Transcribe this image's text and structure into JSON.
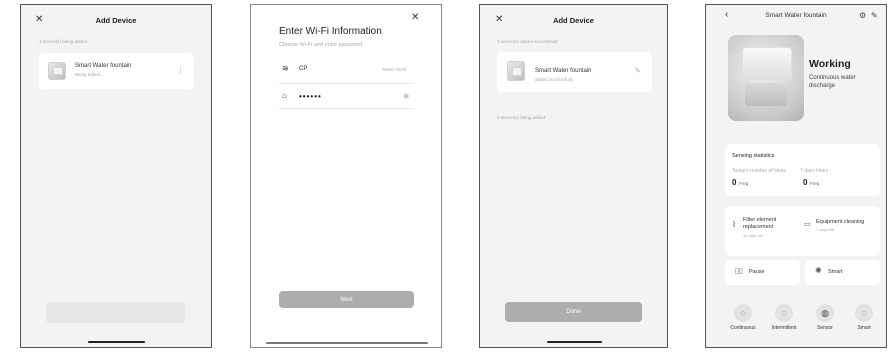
{
  "screen1": {
    "title": "Add Device",
    "section_label": "1 device(s) being added",
    "device_name": "Smart Water fountain",
    "device_status": "Being added..."
  },
  "screen2": {
    "title": "Enter Wi-Fi Information",
    "subtitle": "Choose Wi-Fi and enter password",
    "wifi_name": "CP",
    "select_wifi_label": "Select Wi-Fi",
    "password_value": "••••••",
    "next_button": "Next"
  },
  "screen3": {
    "title": "Add Device",
    "added_label": "1 device(s) added successfully",
    "device_name": "Smart Water fountain",
    "device_status": "added successfully",
    "being_added_label": "0 device(s) being added",
    "done_button": "Done"
  },
  "screen4": {
    "title": "Smart Water fountain",
    "status": "Working",
    "status_desc": "Continuous water discharge",
    "sensing_title": "Sensing statistics",
    "today_label": "Today's number of times",
    "seven_day_label": "7 days times",
    "today_value": "0",
    "today_unit": "Freq",
    "seven_day_value": "0",
    "seven_day_unit": "Freq",
    "filter_label": "Filter element replacement",
    "filter_sub": "30 days left",
    "equipment_label": "Equipment cleaning",
    "equipment_sub": "7 days left",
    "pause_label": "Pause",
    "smart_label": "Smart",
    "modes": [
      {
        "label": "Continuous",
        "icon": "continuous-mode-icon"
      },
      {
        "label": "Intermittent",
        "icon": "intermittent-mode-icon"
      },
      {
        "label": "Sensor",
        "icon": "sensor-mode-icon"
      },
      {
        "label": "Smart",
        "icon": "smart-mode-icon"
      }
    ]
  },
  "colors": {
    "button_disabled": "#e6e6e6",
    "button_gray": "#adadad",
    "background": "#f3f3f3",
    "card": "#ffffff"
  }
}
